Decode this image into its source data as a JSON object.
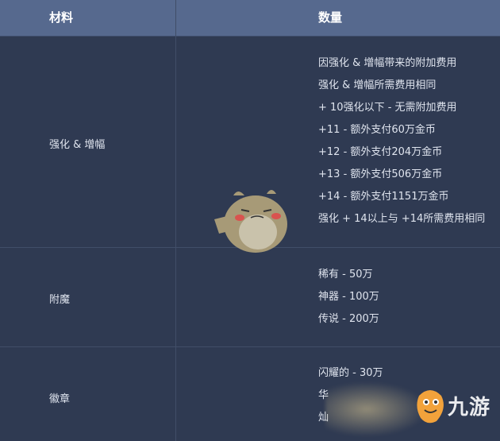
{
  "header": {
    "col_material": "材料",
    "col_quantity": "数量"
  },
  "rows": [
    {
      "label": "强化 & 增幅",
      "lines": [
        "因强化 & 增幅带来的附加费用",
        "强化 & 增幅所需费用相同",
        "+ 10强化以下 - 无需附加费用",
        "+11 - 额外支付60万金币",
        "+12 - 额外支付204万金币",
        "+13 - 额外支付506万金币",
        "+14 - 额外支付1151万金币",
        "强化 + 14以上与 +14所需费用相同"
      ]
    },
    {
      "label": "附魔",
      "lines": [
        "稀有 - 50万",
        "神器 - 100万",
        "传说 - 200万"
      ]
    },
    {
      "label": "徽章",
      "lines": [
        "闪耀的 - 30万",
        "华",
        "灿"
      ]
    }
  ],
  "watermark": {
    "text": "九游",
    "icon": "jiuyou-logo-icon"
  },
  "colors": {
    "background": "#2f3a52",
    "header": "#56698e",
    "grid": "#414e68",
    "text": "#dfe4ee",
    "mascot_body": "#a79a77",
    "logo_orange": "#f2a23b"
  }
}
